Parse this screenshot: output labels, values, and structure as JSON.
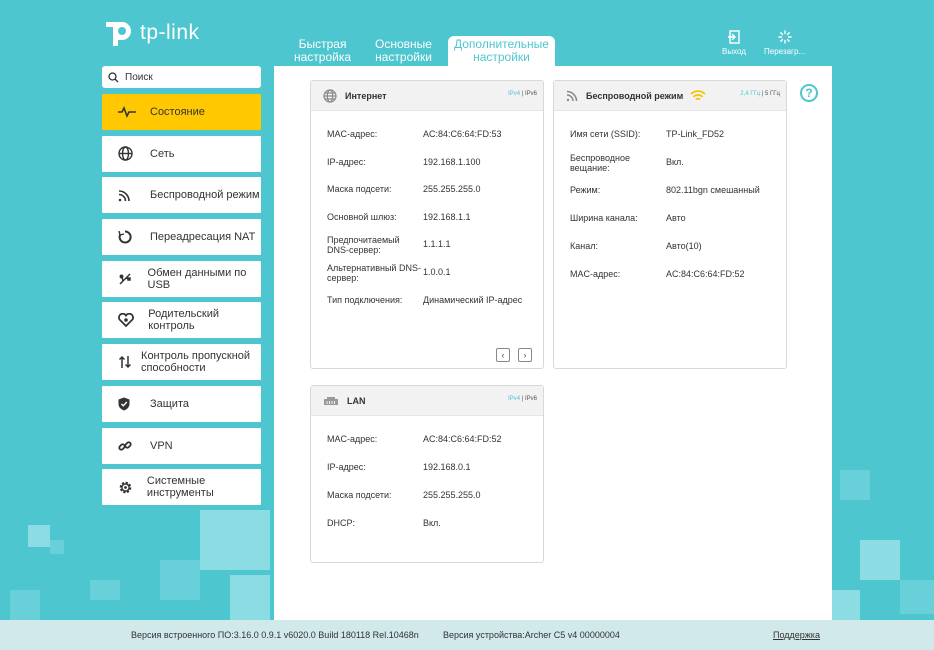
{
  "brand": {
    "name": "tp-link"
  },
  "tabs": [
    {
      "label": "Быстрая настройка",
      "l1": "Быстрая",
      "l2": "настройка"
    },
    {
      "label": "Основные настройки",
      "l1": "Основные",
      "l2": "настройки"
    },
    {
      "label": "Дополнительные настройки",
      "l1": "Дополнительные",
      "l2": "настройки"
    }
  ],
  "header_actions": {
    "logout": "Выход",
    "reboot": "Перезагр..."
  },
  "search": {
    "placeholder": "Поиск"
  },
  "sidebar": {
    "items": [
      {
        "label": "Состояние",
        "icon": "status-icon",
        "active": true
      },
      {
        "label": "Сеть",
        "icon": "globe-icon"
      },
      {
        "label": "Беспроводной режим",
        "icon": "wireless-icon"
      },
      {
        "label": "Переадресация NAT",
        "icon": "nat-icon"
      },
      {
        "label": "Обмен данными по USB",
        "icon": "usb-icon"
      },
      {
        "label": "Родительский контроль",
        "icon": "heart-icon"
      },
      {
        "label": "Контроль пропускной способности",
        "icon": "updown-icon"
      },
      {
        "label": "Защита",
        "icon": "shield-icon"
      },
      {
        "label": "VPN",
        "icon": "vpn-icon"
      },
      {
        "label": "Системные инструменты",
        "icon": "gear-icon"
      }
    ]
  },
  "internet": {
    "title": "Интернет",
    "tags": {
      "a": "IPv4",
      "b": "IPv6"
    },
    "rows": [
      {
        "k": "MAC-адрес:",
        "v": "AC:84:C6:64:FD:53"
      },
      {
        "k": "IP-адрес:",
        "v": "192.168.1.100"
      },
      {
        "k": "Маска подсети:",
        "v": "255.255.255.0"
      },
      {
        "k": "Основной шлюз:",
        "v": "192.168.1.1"
      },
      {
        "k": "Предпочитаемый DNS-сервер:",
        "v": "1.1.1.1"
      },
      {
        "k": "Альтернативный DNS-сервер:",
        "v": "1.0.0.1"
      },
      {
        "k": "Тип подключения:",
        "v": "Динамический IP-адрес"
      }
    ]
  },
  "wireless": {
    "title": "Беспроводной режим",
    "tags": {
      "a": "2,4 ГГц",
      "b": "5 ГГц"
    },
    "rows": [
      {
        "k": "Имя сети (SSID):",
        "v": "TP-Link_FD52"
      },
      {
        "k": "Беспроводное вещание:",
        "v": "Вкл."
      },
      {
        "k": "Режим:",
        "v": "802.11bgn смешанный"
      },
      {
        "k": "Ширина канала:",
        "v": "Авто"
      },
      {
        "k": "Канал:",
        "v": "Авто(10)"
      },
      {
        "k": "MAC-адрес:",
        "v": "AC:84:C6:64:FD:52"
      }
    ]
  },
  "lan": {
    "title": "LAN",
    "tags": {
      "a": "IPv4",
      "b": "IPv6"
    },
    "rows": [
      {
        "k": "MAC-адрес:",
        "v": "AC:84:C6:64:FD:52"
      },
      {
        "k": "IP-адрес:",
        "v": "192.168.0.1"
      },
      {
        "k": "Маска подсети:",
        "v": "255.255.255.0"
      },
      {
        "k": "DHCP:",
        "v": "Вкл."
      }
    ]
  },
  "footer": {
    "firmware": "Версия встроенного ПО:3.16.0 0.9.1 v6020.0 Build 180118 Rel.10468n",
    "hardware": "Версия устройства:Archer C5 v4 00000004",
    "support": "Поддержка"
  },
  "colors": {
    "accent": "#4ec6d0",
    "active": "#ffc800",
    "background": "#4ec6d0"
  }
}
